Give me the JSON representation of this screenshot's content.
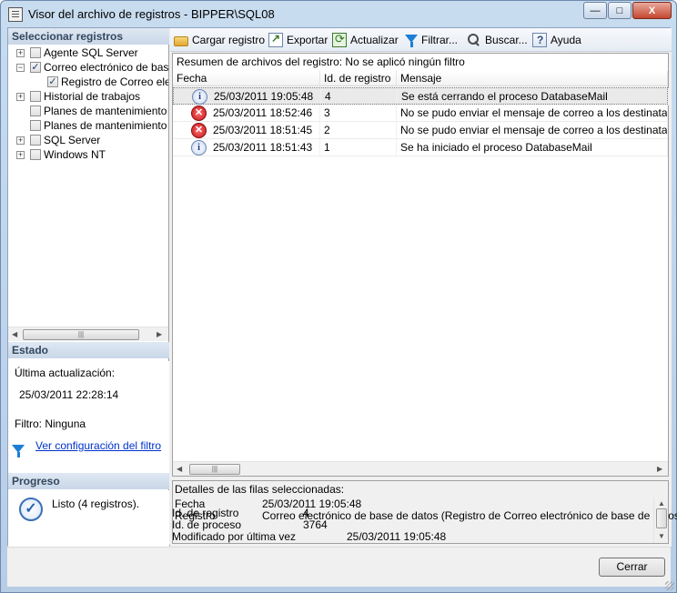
{
  "window": {
    "title": "Visor del archivo de registros - BIPPER\\SQL08",
    "minimize": "—",
    "maximize": "□",
    "close": "X"
  },
  "left": {
    "select_header": "Seleccionar registros",
    "tree": [
      {
        "label": "Agente SQL Server",
        "expander": "+",
        "checked": ""
      },
      {
        "label": "Correo electrónico de base de datos",
        "expander": "−",
        "checked": "✓"
      },
      {
        "label": "Registro de Correo electrónico de base de datos",
        "expander": "",
        "checked": "✓"
      },
      {
        "label": "Historial de trabajos",
        "expander": "+",
        "checked": ""
      },
      {
        "label": "Planes de mantenimiento",
        "expander": "",
        "checked": ""
      },
      {
        "label": "Planes de mantenimiento remotos",
        "expander": "",
        "checked": ""
      },
      {
        "label": "SQL Server",
        "expander": "+",
        "checked": ""
      },
      {
        "label": "Windows NT",
        "expander": "+",
        "checked": ""
      }
    ],
    "estado_header": "Estado",
    "last_update_label": "Última actualización:",
    "last_update_value": "25/03/2011 22:28:14",
    "filter_label": "Filtro: Ninguna",
    "filter_link": "Ver configuración del filtro",
    "progreso_header": "Progreso",
    "progress_text": "Listo (4 registros)."
  },
  "toolbar": {
    "load": "Cargar registro",
    "export": "Exportar",
    "refresh": "Actualizar",
    "filter": "Filtrar...",
    "search": "Buscar...",
    "help": "Ayuda"
  },
  "grid": {
    "summary": "Resumen de archivos del registro: No se aplicó ningún filtro",
    "columns": [
      "Fecha",
      "Id. de registro",
      "Mensaje"
    ],
    "rows": [
      {
        "icon": "info-icon",
        "date": "25/03/2011 19:05:48",
        "id": "4",
        "message": "Se está cerrando el proceso DatabaseMail"
      },
      {
        "icon": "error-icon",
        "date": "25/03/2011 18:52:46",
        "id": "3",
        "message": "No se pudo enviar el mensaje de correo a los destinatarios a causa de un error en el servidor de correo"
      },
      {
        "icon": "error-icon",
        "date": "25/03/2011 18:51:45",
        "id": "2",
        "message": "No se pudo enviar el mensaje de correo a los destinatarios a causa de un error en el servidor de correo"
      },
      {
        "icon": "info-icon",
        "date": "25/03/2011 18:51:43",
        "id": "1",
        "message": "Se ha iniciado el proceso DatabaseMail"
      }
    ]
  },
  "details": {
    "header": "Detalles de las filas seleccionadas:",
    "fecha_label": "Fecha",
    "fecha_value": "25/03/2011 19:05:48",
    "registro_label": "Registro",
    "registro_value": "Correo electrónico de base de datos (Registro de Correo electrónico de base de datos)",
    "id_label": "Id. de registro",
    "id_value": "4",
    "proceso_label": "Id. de proceso",
    "proceso_value": "3764",
    "modificado_label": "Modificado por última vez",
    "modificado_value": "25/03/2011 19:05:48"
  },
  "footer": {
    "close_button": "Cerrar"
  },
  "colors": {
    "accent": "#1e7ed6",
    "header_text": "#33475e",
    "link": "#0033cc",
    "error": "#c4151a"
  }
}
